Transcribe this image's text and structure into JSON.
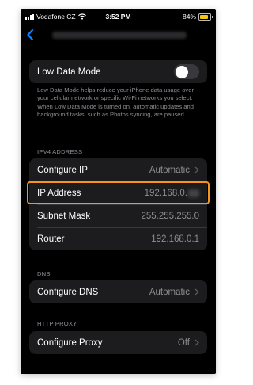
{
  "status_bar": {
    "carrier": "Vodafone CZ",
    "time": "3:52 PM",
    "battery": "84%"
  },
  "low_data": {
    "label": "Low Data Mode",
    "enabled": false,
    "description": "Low Data Mode helps reduce your iPhone data usage over your cellular network or specific Wi-Fi networks you select. When Low Data Mode is turned on, automatic updates and background tasks, such as Photos syncing, are paused."
  },
  "ipv4": {
    "header": "IPV4 ADDRESS",
    "rows": [
      {
        "label": "Configure IP",
        "value": "Automatic"
      },
      {
        "label": "IP Address",
        "value": "192.168.0."
      },
      {
        "label": "Subnet Mask",
        "value": "255.255.255.0"
      },
      {
        "label": "Router",
        "value": "192.168.0.1"
      }
    ]
  },
  "dns": {
    "header": "DNS",
    "label": "Configure DNS",
    "value": "Automatic"
  },
  "proxy": {
    "header": "HTTP PROXY",
    "label": "Configure Proxy",
    "value": "Off"
  },
  "colors": {
    "highlight": "#f7941d",
    "accent": "#0a84ff",
    "toggle_off": "#39393d"
  }
}
